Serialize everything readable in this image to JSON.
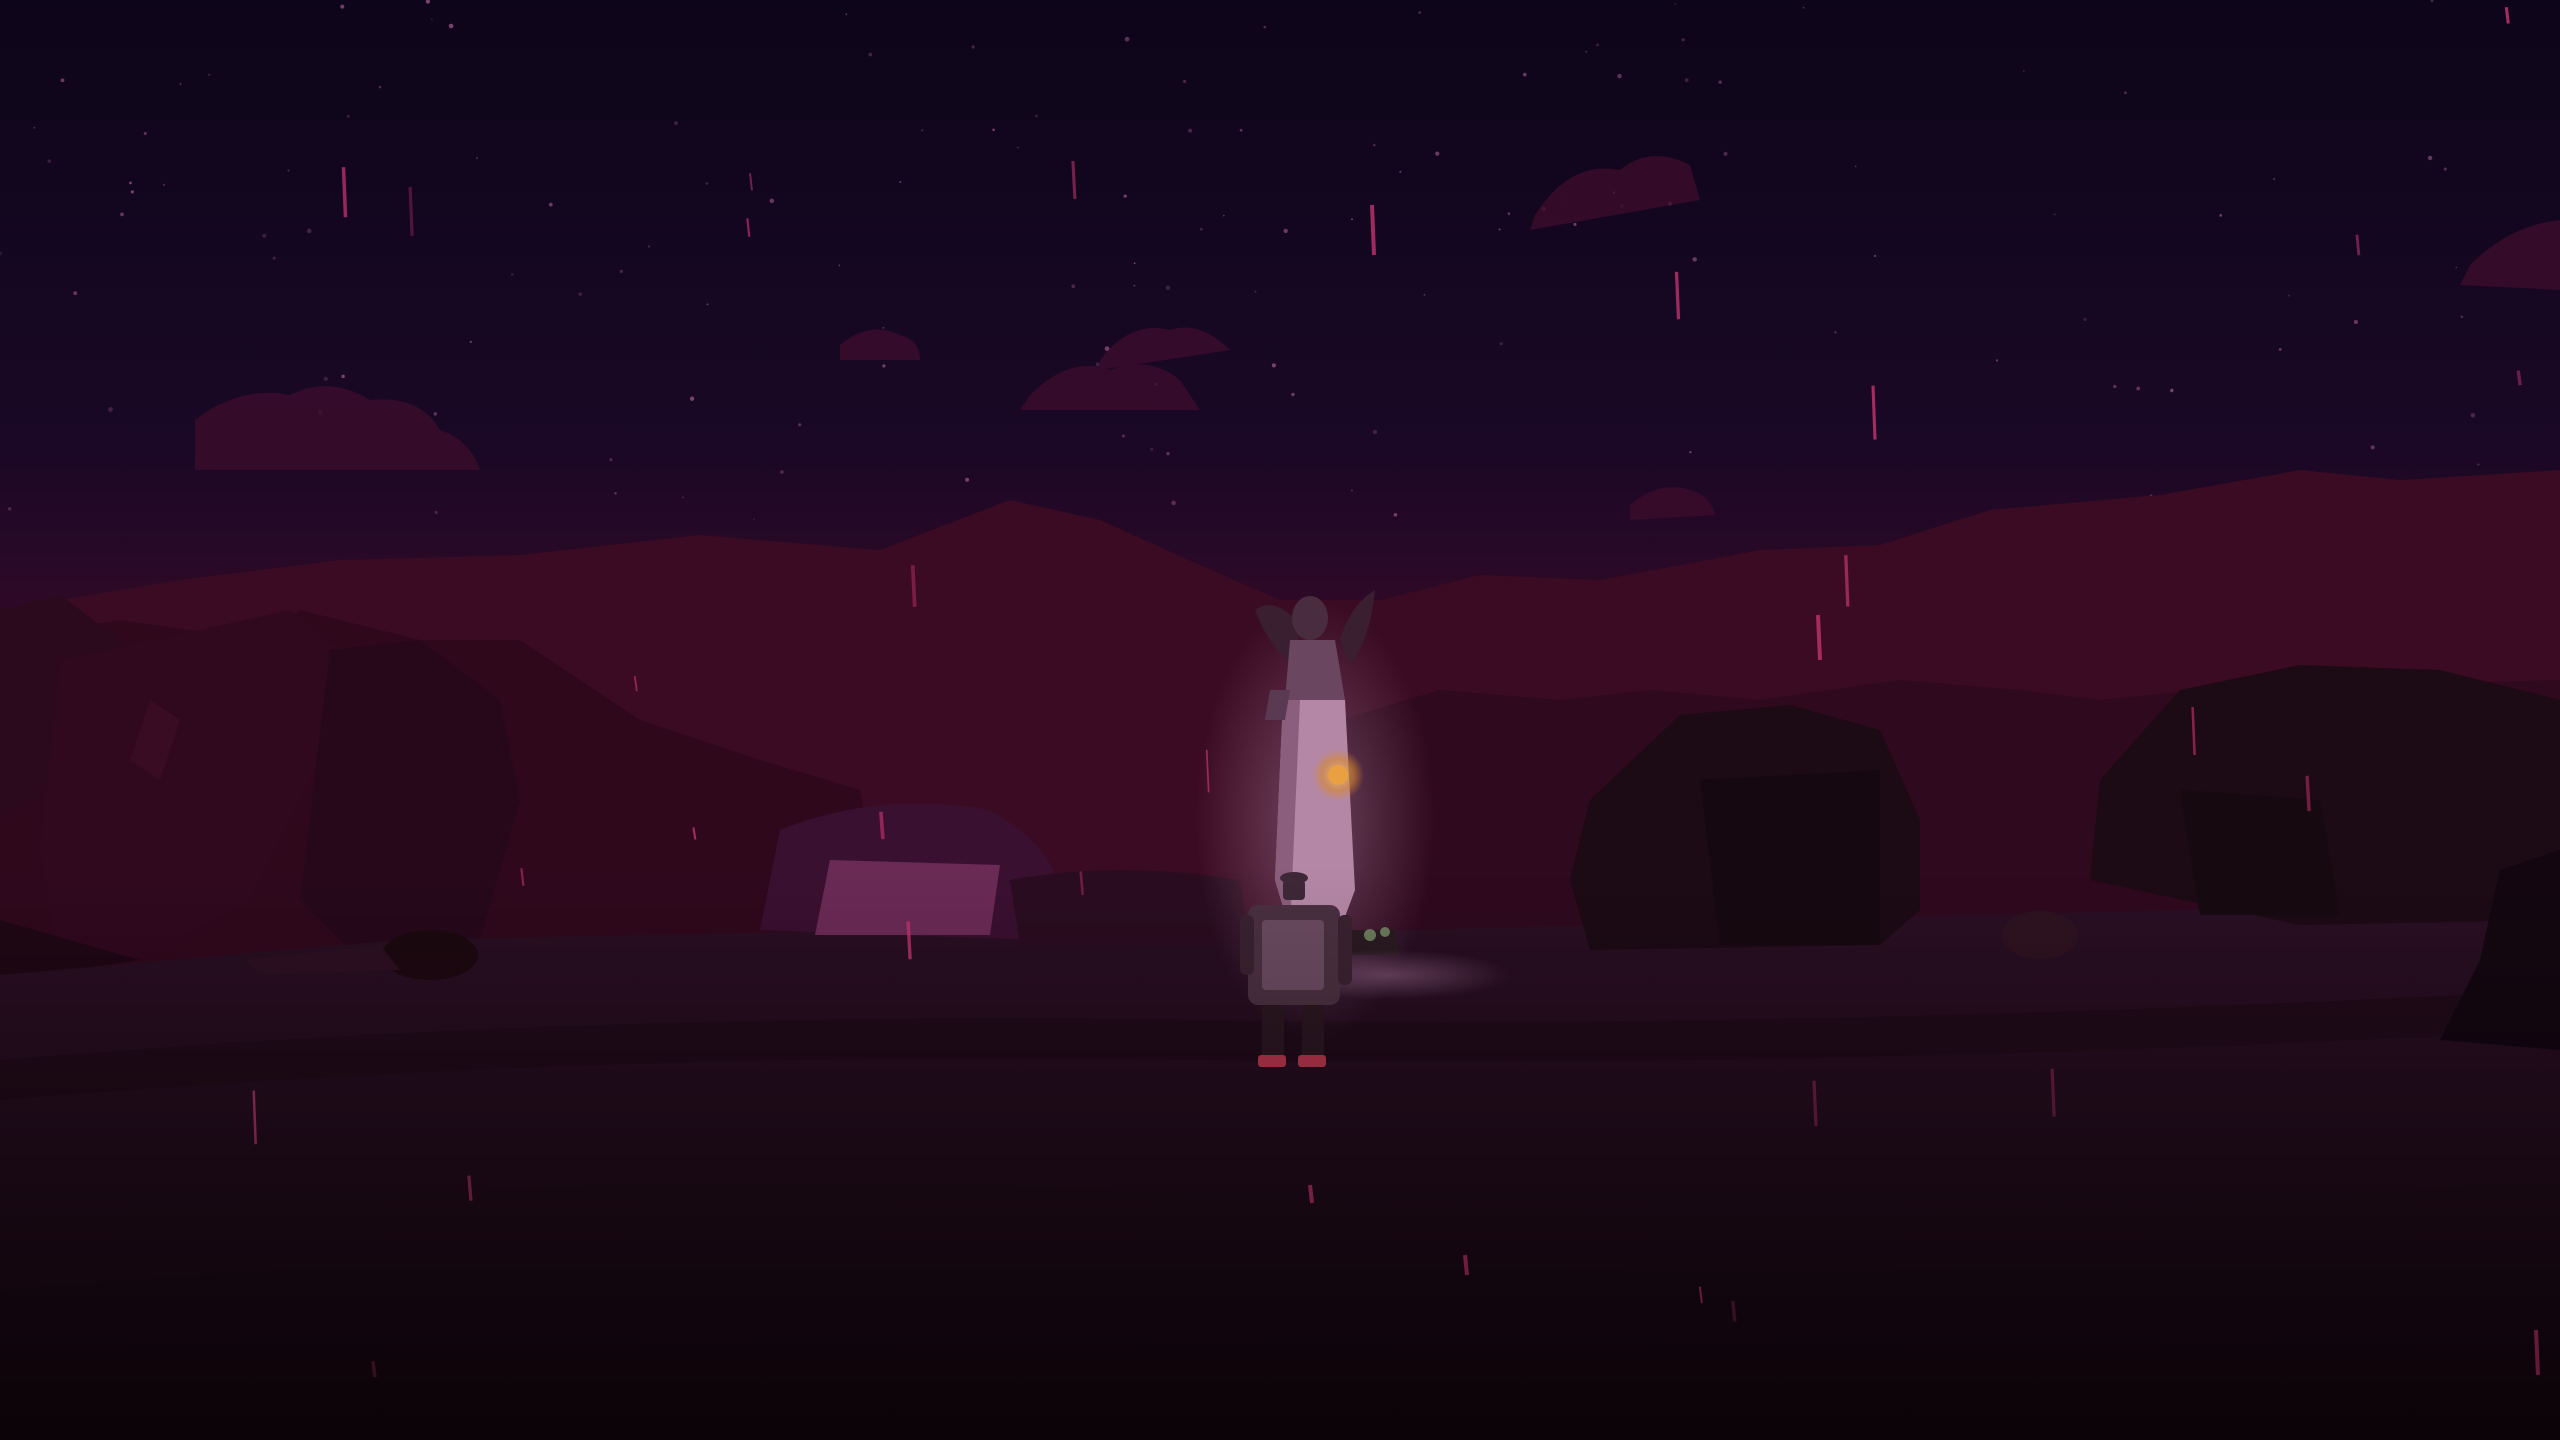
{
  "scene": {
    "description_kind": "third-person game view",
    "time_of_day": "night",
    "weather": "light rain",
    "hud_visible": false
  },
  "colors": {
    "sky_top": "#0d0519",
    "sky_mid": "#1a0826",
    "sky_horizon": "#3a0a28",
    "mountains_far": "#3a0b22",
    "mountains_near": "#2c081c",
    "ground_light": "#2a0f24",
    "ground_dark": "#1a0812",
    "rock_dark": "#1c0a14",
    "statue_light": "#b487a6",
    "statue_shadow": "#5a3a52",
    "orb_glow": "#d98a2b",
    "player_body": "#4a3040",
    "player_accent": "#b0334a",
    "rain": "#c2336e",
    "stars": "#8a4a7a"
  },
  "icons": {
    "statue": "winged-angel-statue",
    "orb": "glowing-orb",
    "player": "robot-character"
  }
}
